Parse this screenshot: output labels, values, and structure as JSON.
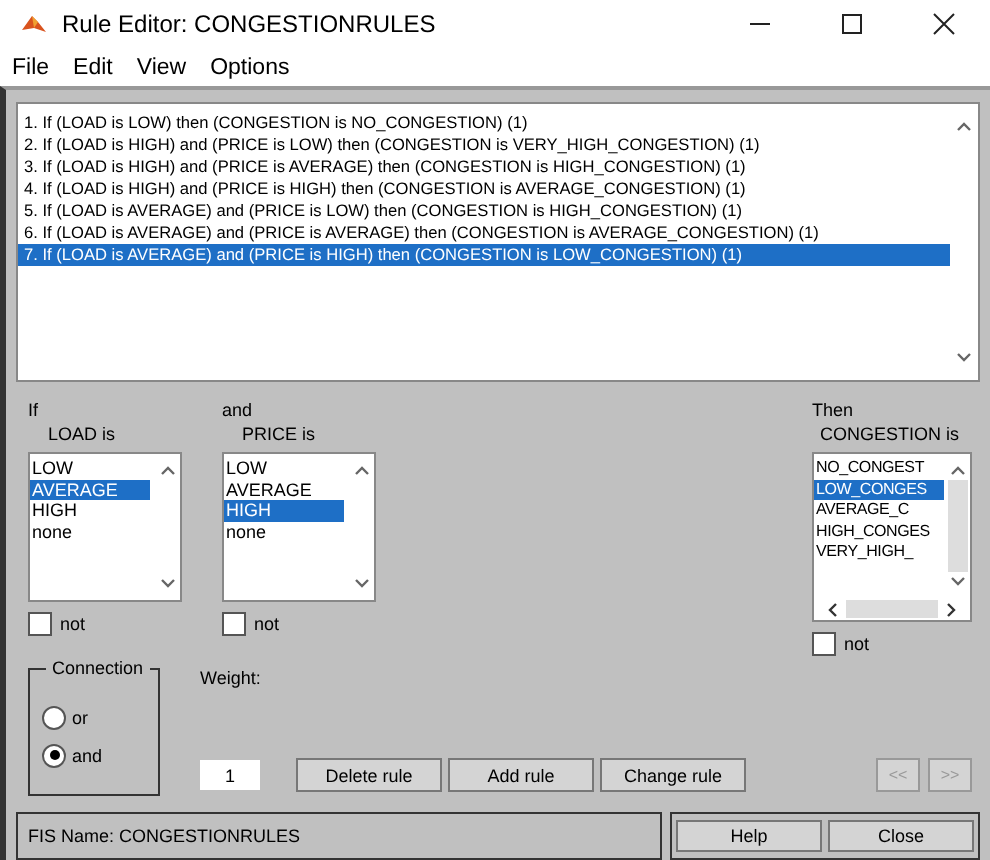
{
  "window": {
    "title": "Rule Editor: CONGESTIONRULES"
  },
  "menu": [
    "File",
    "Edit",
    "View",
    "Options"
  ],
  "rules": [
    {
      "text": "1. If (LOAD is LOW) then (CONGESTION is NO_CONGESTION) (1)",
      "selected": false
    },
    {
      "text": "2. If (LOAD is HIGH) and (PRICE is LOW) then (CONGESTION is VERY_HIGH_CONGESTION) (1)",
      "selected": false
    },
    {
      "text": "3. If (LOAD is HIGH) and (PRICE is AVERAGE) then (CONGESTION is HIGH_CONGESTION) (1)",
      "selected": false
    },
    {
      "text": "4. If (LOAD is HIGH) and (PRICE is HIGH) then (CONGESTION is AVERAGE_CONGESTION) (1)",
      "selected": false
    },
    {
      "text": "5. If (LOAD is AVERAGE) and (PRICE is LOW) then (CONGESTION is HIGH_CONGESTION) (1)",
      "selected": false
    },
    {
      "text": "6. If (LOAD is AVERAGE) and (PRICE is AVERAGE) then (CONGESTION is AVERAGE_CONGESTION) (1)",
      "selected": false
    },
    {
      "text": "7. If (LOAD is AVERAGE) and (PRICE is HIGH) then (CONGESTION is LOW_CONGESTION) (1)",
      "selected": true
    }
  ],
  "antecedents": [
    {
      "heading": "If",
      "label": "LOAD is",
      "options": [
        {
          "label": "LOW",
          "selected": false
        },
        {
          "label": "AVERAGE",
          "selected": true
        },
        {
          "label": "HIGH",
          "selected": false
        },
        {
          "label": "none",
          "selected": false
        }
      ],
      "not": {
        "label": "not",
        "checked": false
      }
    },
    {
      "heading": "and",
      "label": "PRICE is",
      "options": [
        {
          "label": "LOW",
          "selected": false
        },
        {
          "label": "AVERAGE",
          "selected": false
        },
        {
          "label": "HIGH",
          "selected": true
        },
        {
          "label": "none",
          "selected": false
        }
      ],
      "not": {
        "label": "not",
        "checked": false
      }
    }
  ],
  "consequent": {
    "heading": "Then",
    "label": "CONGESTION is",
    "options": [
      {
        "label": "NO_CONGEST",
        "selected": false
      },
      {
        "label": "LOW_CONGES",
        "selected": true
      },
      {
        "label": "AVERAGE_C",
        "selected": false
      },
      {
        "label": "HIGH_CONGES",
        "selected": false
      },
      {
        "label": "VERY_HIGH_",
        "selected": false
      }
    ],
    "not": {
      "label": "not",
      "checked": false
    }
  },
  "connection": {
    "title": "Connection",
    "options": [
      {
        "label": "or",
        "selected": false
      },
      {
        "label": "and",
        "selected": true
      }
    ]
  },
  "weight": {
    "label": "Weight:",
    "value": "1"
  },
  "buttons": [
    "Delete rule",
    "Add rule",
    "Change rule"
  ],
  "nav_buttons": [
    {
      "label": "<<",
      "disabled": true
    },
    {
      "label": ">>",
      "disabled": true
    }
  ],
  "status": "FIS Name: CONGESTIONRULES",
  "footer_buttons": [
    "Help",
    "Close"
  ]
}
